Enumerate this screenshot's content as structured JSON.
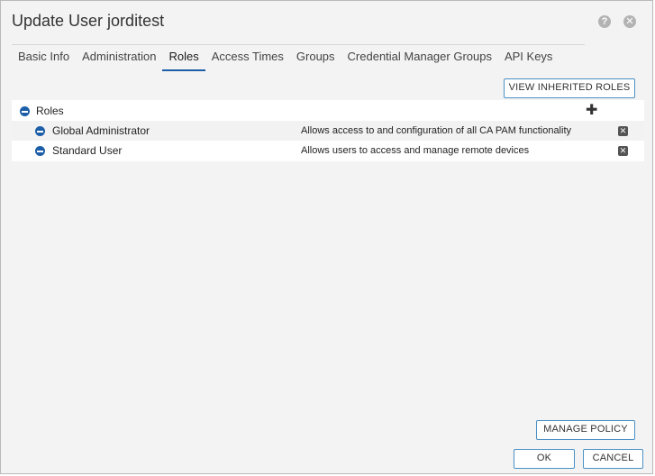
{
  "dialog": {
    "title": "Update User jorditest",
    "help_icon": "question-circle-icon",
    "close_icon": "close-circle-icon"
  },
  "tabs": [
    {
      "label": "Basic Info",
      "active": false
    },
    {
      "label": "Administration",
      "active": false
    },
    {
      "label": "Roles",
      "active": true
    },
    {
      "label": "Access Times",
      "active": false
    },
    {
      "label": "Groups",
      "active": false
    },
    {
      "label": "Credential Manager Groups",
      "active": false
    },
    {
      "label": "API Keys",
      "active": false
    }
  ],
  "toolbar": {
    "view_inherited_label": "VIEW INHERITED ROLES"
  },
  "roles": {
    "header": "Roles",
    "add_icon": "plus-icon",
    "items": [
      {
        "name": "Global Administrator",
        "description": "Allows access to and configuration of all CA PAM functionality"
      },
      {
        "name": "Standard User",
        "description": "Allows users to access and manage remote devices"
      }
    ]
  },
  "footer": {
    "manage_policy_label": "MANAGE POLICY",
    "ok_label": "OK",
    "cancel_label": "CANCEL"
  },
  "colors": {
    "accent": "#1d5ea8",
    "button_border": "#4b90c5",
    "dialog_bg": "#f3f3f3"
  }
}
